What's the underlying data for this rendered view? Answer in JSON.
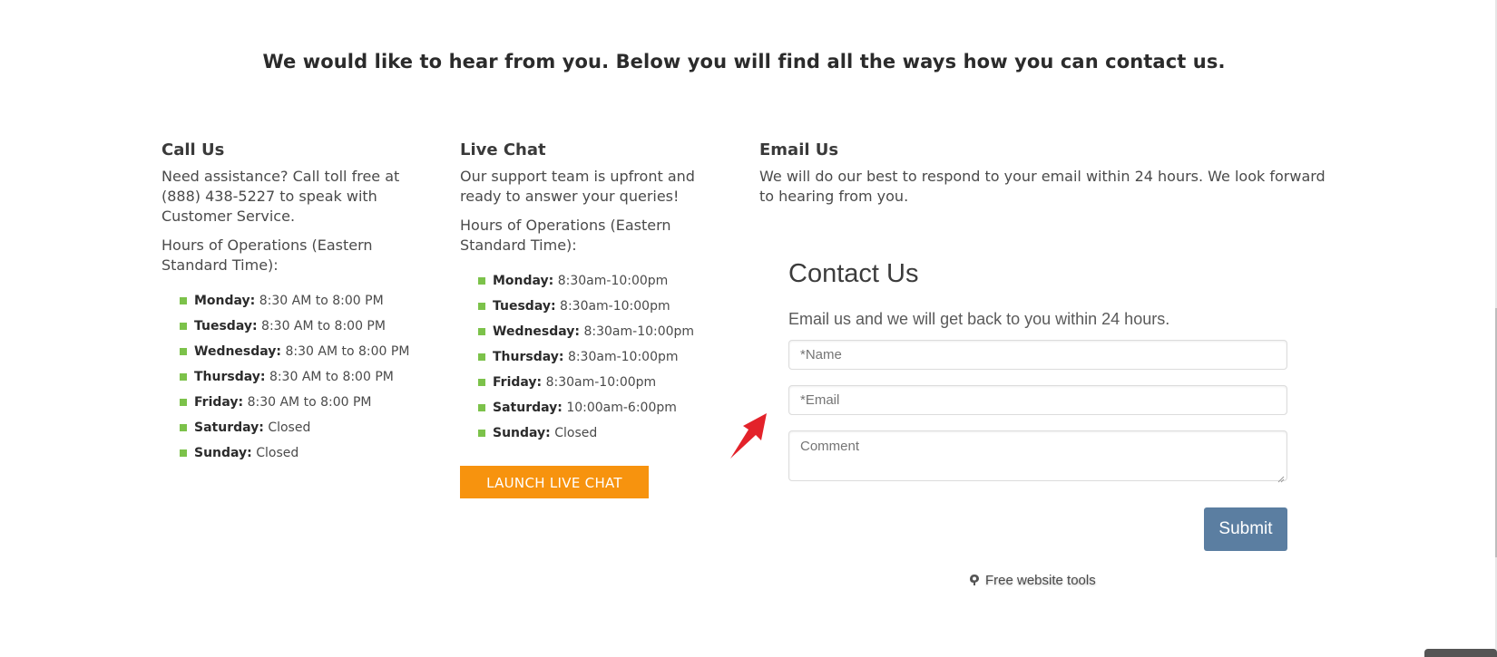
{
  "headline": "We would like to hear from you. Below you will find all the ways how you can contact us.",
  "call_us": {
    "title": "Call Us",
    "description": "Need assistance? Call toll free at (888) 438-5227 to speak with Customer Service.",
    "hours_title": "Hours of Operations (Eastern Standard Time):",
    "hours": [
      {
        "day": "Monday:",
        "time": "8:30 AM to 8:00 PM"
      },
      {
        "day": "Tuesday:",
        "time": "8:30 AM to 8:00 PM"
      },
      {
        "day": "Wednesday:",
        "time": "8:30 AM to 8:00 PM"
      },
      {
        "day": "Thursday:",
        "time": "8:30 AM to 8:00 PM"
      },
      {
        "day": "Friday:",
        "time": "8:30 AM to 8:00 PM"
      },
      {
        "day": "Saturday:",
        "time": "Closed"
      },
      {
        "day": "Sunday:",
        "time": "Closed"
      }
    ]
  },
  "live_chat": {
    "title": "Live Chat",
    "description": "Our support team is upfront and ready to answer your queries!",
    "hours_title": "Hours of Operations (Eastern Standard Time):",
    "hours": [
      {
        "day": "Monday:",
        "time": "8:30am-10:00pm"
      },
      {
        "day": "Tuesday:",
        "time": "8:30am-10:00pm"
      },
      {
        "day": "Wednesday:",
        "time": "8:30am-10:00pm"
      },
      {
        "day": "Thursday:",
        "time": "8:30am-10:00pm"
      },
      {
        "day": "Friday:",
        "time": "8:30am-10:00pm"
      },
      {
        "day": "Saturday:",
        "time": "10:00am-6:00pm"
      },
      {
        "day": "Sunday:",
        "time": "Closed"
      }
    ],
    "button_label": "LAUNCH LIVE CHAT"
  },
  "email_us": {
    "title": "Email Us",
    "description": "We will do our best to respond to your email within 24 hours. We look forward to hearing from you."
  },
  "contact_form": {
    "title": "Contact Us",
    "subtitle": "Email us and we will get back to you within 24 hours.",
    "name_placeholder": "*Name",
    "email_placeholder": "*Email",
    "comment_placeholder": "Comment",
    "submit_label": "Submit"
  },
  "footer_link": {
    "label": "Free website tools",
    "icon": "tools-logo-icon"
  },
  "colors": {
    "bullet": "#7cc24a",
    "launch_button": "#f7930e",
    "submit_button": "#5b7ea1",
    "arrow": "#e3222a"
  }
}
